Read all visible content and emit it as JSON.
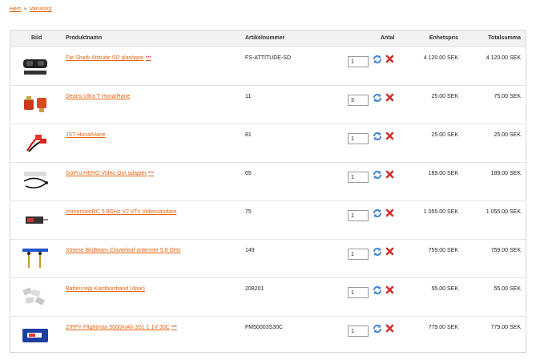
{
  "breadcrumb": {
    "home": "Hem",
    "separator": "»",
    "current": "Varukorg"
  },
  "table": {
    "headers": {
      "image": "Bild",
      "name": "Produktnamn",
      "sku": "Artikelnummer",
      "qty": "Antal",
      "unit_price": "Enhetspris",
      "total": "Totalsumma"
    },
    "rows": [
      {
        "name": "Fat Shark Attitude SD glasögon",
        "star": "***",
        "sku": "FS-ATTITUDE-SD",
        "qty": "1",
        "unit": "4 120.00 SEK",
        "total": "4 120.00 SEK",
        "thumb": "goggles"
      },
      {
        "name": "Deans Ultra T Hona/Hane",
        "star": "",
        "sku": "11",
        "qty": "3",
        "unit": "25.00 SEK",
        "total": "75.00 SEK",
        "thumb": "deans"
      },
      {
        "name": "JST Hona/Hane",
        "star": "",
        "sku": "81",
        "qty": "1",
        "unit": "25.00 SEK",
        "total": "25.00 SEK",
        "thumb": "jst"
      },
      {
        "name": "GoPro HERO Video Out adapter",
        "star": "***",
        "sku": "65",
        "qty": "1",
        "unit": "189.00 SEK",
        "total": "189.00 SEK",
        "thumb": "cable"
      },
      {
        "name": "ImmersionRC 5.8GHz V2 VTx Videosändare",
        "star": "",
        "sku": "75",
        "qty": "1",
        "unit": "1 055.00 SEK",
        "total": "1 055.00 SEK",
        "thumb": "vtx"
      },
      {
        "name": "Xtreme BluBeam Cloverleaf antenner 5.8 GHz",
        "star": "",
        "sku": "149",
        "qty": "1",
        "unit": "759.00 SEK",
        "total": "759.00 SEK",
        "thumb": "antenna"
      },
      {
        "name": "Batteri tejp Kardborrband (4par)",
        "star": "",
        "sku": "208201",
        "qty": "1",
        "unit": "55.00 SEK",
        "total": "55.00 SEK",
        "thumb": "velcro"
      },
      {
        "name": "ZIPPY Flightmax 5000mAh 3S1 1 1V 30C",
        "star": "***",
        "sku": "FM50003S30C",
        "qty": "1",
        "unit": "779.00 SEK",
        "total": "779.00 SEK",
        "thumb": "battery"
      }
    ]
  },
  "colors": {
    "link": "#e8650e",
    "star": "#d10000",
    "refresh": "#3d86d6",
    "remove": "#d62b2b"
  },
  "icons": {
    "refresh": "refresh-icon",
    "remove": "remove-icon"
  }
}
